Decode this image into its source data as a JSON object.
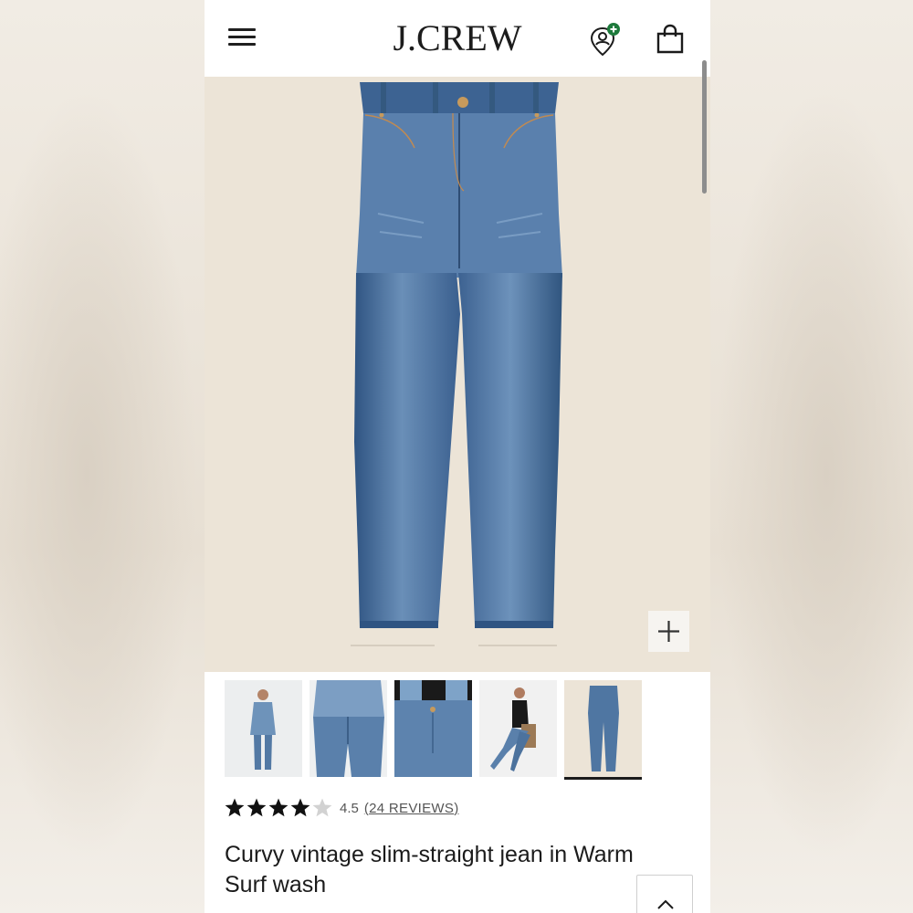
{
  "header": {
    "brand": "J.CREW",
    "menu_icon": "hamburger-menu-icon",
    "account_icon": "account-pin-icon",
    "bag_icon": "shopping-bag-icon"
  },
  "gallery": {
    "main_image": "Curvy vintage slim-straight jean in Warm Surf wash, flat lay",
    "zoom_icon": "plus-icon",
    "thumbnails": [
      {
        "name": "model-front-denim-jacket"
      },
      {
        "name": "model-back-denim-jacket"
      },
      {
        "name": "waist-closeup"
      },
      {
        "name": "model-seated-black-top"
      },
      {
        "name": "flat-lay-jean",
        "selected": true
      }
    ]
  },
  "product": {
    "rating": {
      "value": 4.5,
      "label": "4.5",
      "reviews_label": "24 REVIEWS",
      "paren_open": "(",
      "paren_close": ")"
    },
    "title": "Curvy vintage slim-straight jean in Warm Surf wash"
  },
  "colors": {
    "hero_background": "#ece4d7",
    "denim": "#4b73a0",
    "text": "#1b1b1b",
    "badge_green": "#1e7a3c"
  },
  "controls": {
    "back_to_top_icon": "chevron-up-icon"
  }
}
